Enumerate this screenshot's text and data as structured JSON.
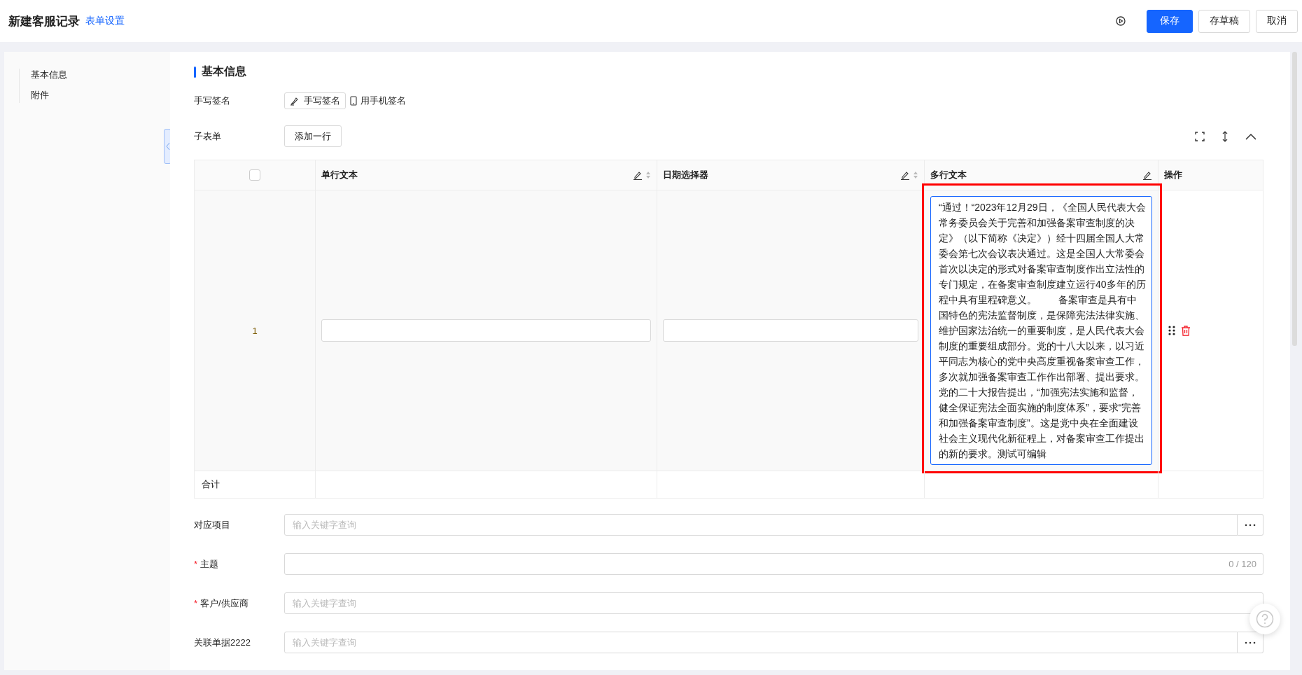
{
  "header": {
    "title": "新建客服记录",
    "settings_link": "表单设置",
    "buttons": [
      {
        "label": "保存",
        "kind": "primary"
      },
      {
        "label": "存草稿",
        "kind": "default"
      },
      {
        "label": "取消",
        "kind": "default"
      }
    ]
  },
  "sidebar": {
    "items": [
      {
        "label": "基本信息"
      },
      {
        "label": "附件"
      }
    ]
  },
  "section_title": "基本信息",
  "signature": {
    "label": "手写签名",
    "handwrite_button": "手写签名",
    "phone_button": "用手机签名"
  },
  "subform": {
    "label": "子表单",
    "add_button": "添加一行",
    "select_all_checked": false,
    "columns": [
      {
        "label": "单行文本",
        "sortable": true
      },
      {
        "label": "日期选择器",
        "sortable": true
      },
      {
        "label": "多行文本",
        "sortable": false
      },
      {
        "label": "操作",
        "kind": "actions"
      }
    ],
    "rows": [
      {
        "index": "1",
        "single_line_text": "",
        "date": "",
        "multiline_text": "“通过！“2023年12月29日，《全国人民代表大会常务委员会关于完善和加强备案审查制度的决定》（以下简称《决定》）经十四届全国人大常委会第七次会议表决通过。这是全国人大常委会首次以决定的形式对备案审查制度作出立法性的专门规定，在备案审查制度建立运行40多年的历程中具有里程碑意义。        备案审查是具有中国特色的宪法监督制度，是保障宪法法律实施、维护国家法治统一的重要制度，是人民代表大会制度的重要组成部分。党的十八大以来，以习近平同志为核心的党中央高度重视备案审查工作，多次就加强备案审查工作作出部署、提出要求。党的二十大报告提出，“加强宪法实施和监督，健全保证宪法全面实施的制度体系”，要求“完善和加强备案审查制度”。这是党中央在全面建设社会主义现代化新征程上，对备案审查工作提出的新的要求。测试可编辑",
        "highlighted": true
      }
    ],
    "total_label": "合计"
  },
  "fields": [
    {
      "label": "对应项目",
      "kind": "lookup",
      "placeholder": "输入关键字查询",
      "more_button_visible": true
    },
    {
      "label": "主题",
      "required_mark": "*",
      "kind": "text",
      "counter": "0 / 120"
    },
    {
      "label": "客户/供应商",
      "required_mark": "*",
      "kind": "lookup",
      "placeholder": "输入关键字查询",
      "more_button_visible": false
    },
    {
      "label": "关联单据2222",
      "kind": "lookup",
      "placeholder": "输入关键字查询",
      "more_button_visible": true
    }
  ]
}
